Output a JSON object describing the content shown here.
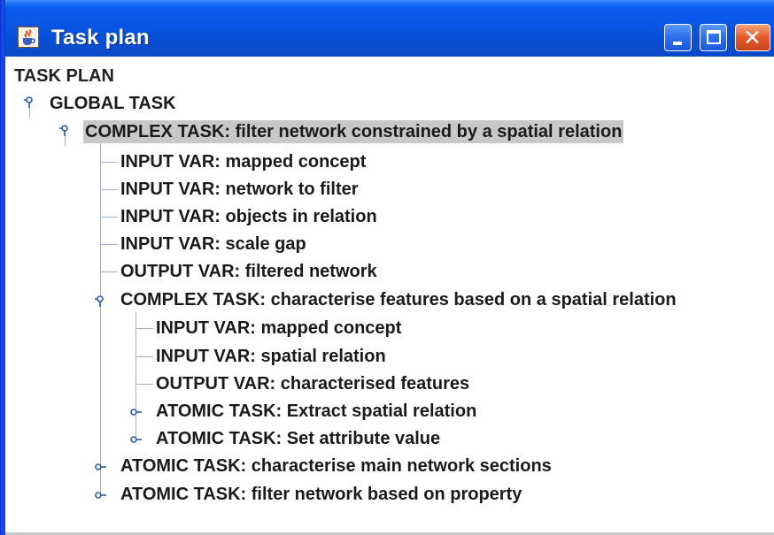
{
  "window": {
    "title": "Task plan",
    "icon": "java-cup-icon",
    "controls": {
      "minimize": "minimize-icon",
      "maximize": "maximize-icon",
      "close": "close-icon",
      "close_glyph": "✕"
    }
  },
  "tree": {
    "root": "TASK PLAN",
    "nodes": [
      {
        "label": "GLOBAL TASK",
        "expanded": true
      },
      {
        "label": "COMPLEX TASK: filter network constrained by a spatial relation",
        "expanded": true,
        "selected": true
      },
      {
        "label": "INPUT VAR: mapped concept"
      },
      {
        "label": "INPUT VAR: network to filter"
      },
      {
        "label": "INPUT VAR: objects in relation"
      },
      {
        "label": "INPUT VAR: scale gap"
      },
      {
        "label": "OUTPUT VAR: filtered network"
      },
      {
        "label": "COMPLEX TASK: characterise features based on a spatial relation",
        "expanded": true
      },
      {
        "label": "INPUT VAR: mapped concept"
      },
      {
        "label": "INPUT VAR: spatial relation"
      },
      {
        "label": "OUTPUT VAR: characterised features"
      },
      {
        "label": "ATOMIC TASK: Extract spatial relation",
        "expanded": false
      },
      {
        "label": "ATOMIC TASK: Set attribute value",
        "expanded": false
      },
      {
        "label": "ATOMIC TASK: characterise main network sections",
        "expanded": false
      },
      {
        "label": "ATOMIC TASK: filter network based on property",
        "expanded": false
      }
    ]
  },
  "colors": {
    "title_bar": "#0a56e6",
    "selection": "#c8c8c8",
    "tree_lines": "#9ab0d4",
    "close_button": "#e45a2c"
  }
}
